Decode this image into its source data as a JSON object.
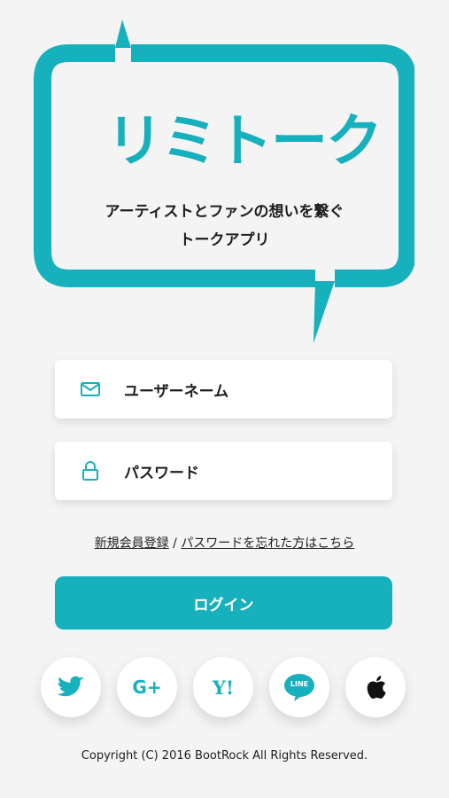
{
  "colors": {
    "accent": "#17b0bd",
    "text": "#1e1e1e",
    "background": "#f4f4f4"
  },
  "logo": {
    "name": "リミトーク",
    "tagline_line1": "アーティストとファンの想いを繋ぐ",
    "tagline_line2": "トークアプリ"
  },
  "form": {
    "username": {
      "label": "ユーザーネーム",
      "icon": "mail-icon"
    },
    "password": {
      "label": "パスワード",
      "icon": "lock-icon"
    }
  },
  "links": {
    "register": "新規会員登録",
    "separator": " / ",
    "forgot": "パスワードを忘れた方はこちら"
  },
  "login_button": "ログイン",
  "social": [
    {
      "name": "twitter",
      "icon": "twitter-icon",
      "color": "#17b0bd"
    },
    {
      "name": "google-plus",
      "icon": "google-plus-icon",
      "label": "G+",
      "color": "#17b0bd"
    },
    {
      "name": "yahoo",
      "icon": "yahoo-icon",
      "label": "Y!",
      "color": "#17b0bd"
    },
    {
      "name": "line",
      "icon": "line-icon",
      "label": "LINE",
      "color": "#17b0bd"
    },
    {
      "name": "apple",
      "icon": "apple-icon",
      "color": "#111111"
    }
  ],
  "footer": {
    "copyright": "Copyright (C) 2016 BootRock All Rights Reserved."
  }
}
